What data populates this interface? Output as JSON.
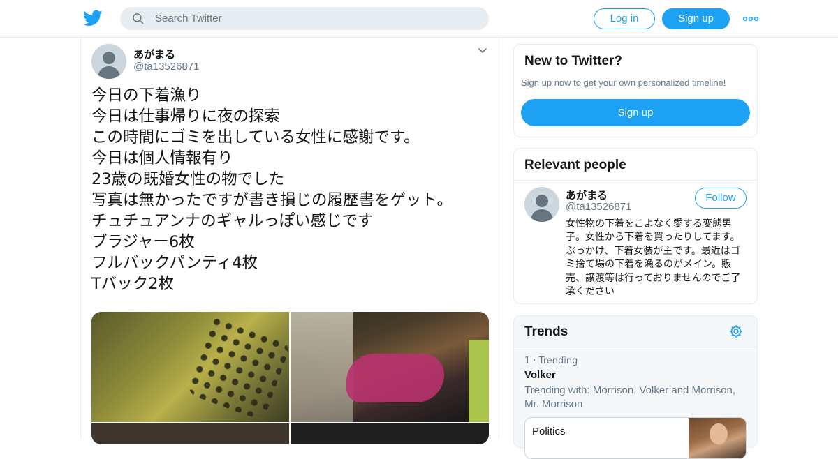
{
  "colors": {
    "accent": "#1da1f2",
    "text": "#14171a",
    "muted": "#657786",
    "border": "#e6ecf0"
  },
  "header": {
    "search_placeholder": "Search Twitter",
    "login_label": "Log in",
    "signup_label": "Sign up",
    "icons": [
      "twitter-bird-icon",
      "search-icon",
      "more-dots-icon"
    ]
  },
  "tweet": {
    "author_name": "あがまる",
    "author_handle": "@ta13526871",
    "lines": [
      "今日の下着漁り",
      "今日は仕事帰りに夜の探索",
      "この時間にゴミを出している女性に感謝です。",
      "今日は個人情報有り",
      "23歳の既婚女性の物でした",
      "写真は無かったですが書き損じの履歴書をゲット。",
      "チュチュアンナのギャルっぽい感じです",
      "ブラジャー6枚",
      "フルバックパンティ4枚",
      "Tバック2枚"
    ]
  },
  "new_to_twitter": {
    "title": "New to Twitter?",
    "subtitle": "Sign up now to get your own personalized timeline!",
    "signup_label": "Sign up"
  },
  "relevant_people": {
    "title": "Relevant people",
    "name": "あがまる",
    "handle": "@ta13526871",
    "follow_label": "Follow",
    "bio": "女性物の下着をこよなく愛する変態男子。女性から下着を買ったりしてます。ぶっかけ、下着女装が主です。最近はゴミ捨て場の下着を漁るのがメイン。販売、譲渡等は行っておりませんのでご了承ください"
  },
  "trends": {
    "title": "Trends",
    "items": [
      {
        "meta": "1 · Trending",
        "name": "Volker",
        "with": "Trending with: Morrison, Volker and Morrison, Mr. Morrison",
        "card_label": "Politics"
      }
    ]
  }
}
